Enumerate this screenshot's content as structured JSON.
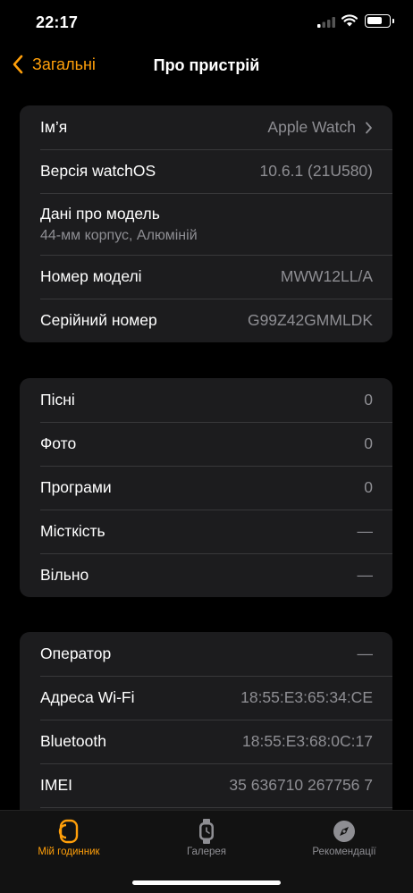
{
  "status_bar": {
    "time": "22:17",
    "battery_level": 0.72
  },
  "nav": {
    "back_label": "Загальні",
    "title": "Про пристрій"
  },
  "groups": [
    {
      "rows": [
        {
          "label": "Ім’я",
          "value": "Apple Watch",
          "has_chevron": true
        },
        {
          "label": "Версія watchOS",
          "value": "10.6.1 (21U580)"
        },
        {
          "label": "Дані про модель",
          "subtitle": "44-мм корпус, Алюміній"
        },
        {
          "label": "Номер моделі",
          "value": "MWW12LL/A"
        },
        {
          "label": "Серійний номер",
          "value": "G99Z42GMMLDK"
        }
      ]
    },
    {
      "rows": [
        {
          "label": "Пісні",
          "value": "0"
        },
        {
          "label": "Фото",
          "value": "0"
        },
        {
          "label": "Програми",
          "value": "0"
        },
        {
          "label": "Місткість",
          "value": "—"
        },
        {
          "label": "Вільно",
          "value": "—"
        }
      ]
    },
    {
      "rows": [
        {
          "label": "Оператор",
          "value": "—"
        },
        {
          "label": "Адреса Wi-Fi",
          "value": "18:55:E3:65:34:CE"
        },
        {
          "label": "Bluetooth",
          "value": "18:55:E3:68:0C:17"
        },
        {
          "label": "IMEI",
          "value": "35 636710 267756 7"
        },
        {
          "label": "",
          "value": ""
        }
      ]
    }
  ],
  "tabs": [
    {
      "label": "Мій годинник",
      "icon": "watch-face-icon",
      "active": true
    },
    {
      "label": "Галерея",
      "icon": "watch-icon",
      "active": false
    },
    {
      "label": "Рекомендації",
      "icon": "compass-icon",
      "active": false
    }
  ],
  "colors": {
    "accent": "#ff9f0a",
    "background": "#000000",
    "group_background": "#1c1c1e",
    "secondary_text": "#8e8e93",
    "inactive_tab": "#8e8e93"
  }
}
